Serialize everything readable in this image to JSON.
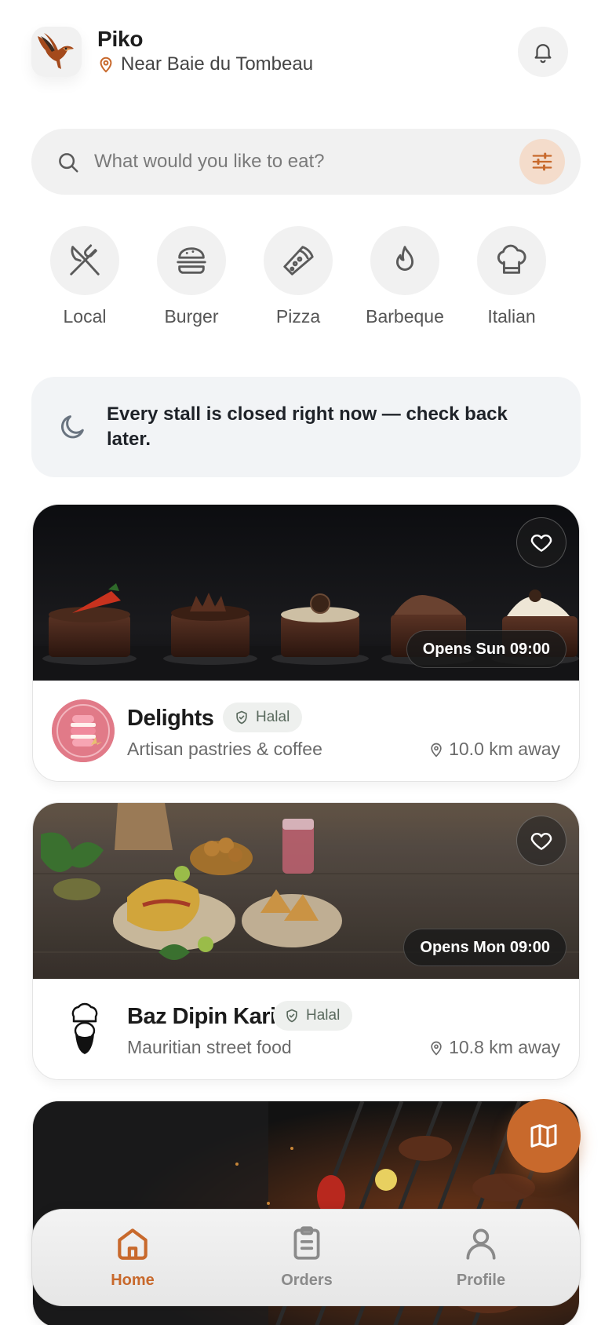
{
  "header": {
    "app_name": "Piko",
    "location": "Near Baie du Tombeau"
  },
  "search": {
    "placeholder": "What would you like to eat?"
  },
  "categories": [
    {
      "label": "Local",
      "icon": "utensils-crossed-icon"
    },
    {
      "label": "Burger",
      "icon": "burger-icon"
    },
    {
      "label": "Pizza",
      "icon": "pizza-icon"
    },
    {
      "label": "Barbeque",
      "icon": "flame-icon"
    },
    {
      "label": "Italian",
      "icon": "chef-hat-icon"
    }
  ],
  "notice": {
    "text": "Every stall is closed right now — check back later."
  },
  "stalls": [
    {
      "name": "Delights",
      "badge": "Halal",
      "tagline": "Artisan pastries & coffee",
      "distance": "10.0 km away",
      "opens": "Opens Sun 09:00"
    },
    {
      "name": "Baz Dipin Kari",
      "badge": "Halal",
      "tagline": "Mauritian street food",
      "distance": "10.8 km away",
      "opens": "Opens Mon 09:00"
    }
  ],
  "nav": {
    "home": "Home",
    "orders": "Orders",
    "profile": "Profile"
  },
  "colors": {
    "accent": "#c8692c",
    "accent_soft": "#f4dccb",
    "surface": "#f1f1f1"
  }
}
